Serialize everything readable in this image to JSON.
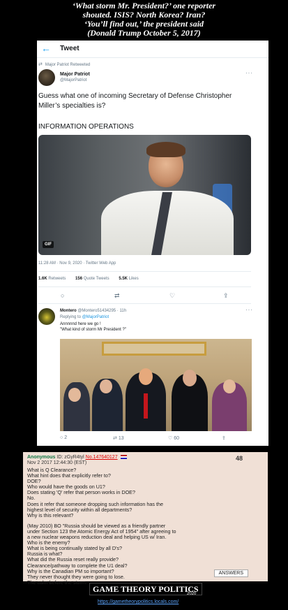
{
  "caption": {
    "line1": "‘What storm Mr. President?’ one reporter",
    "line2": "shouted. ISIS? North Korea? Iran?",
    "line3": "‘You’ll find out,’ the president said",
    "line4": "(Donald Trump October 5, 2017)"
  },
  "tweet": {
    "header_title": "Tweet",
    "retweet_label": "Major Patriot Retweeted",
    "author_name": "Major Patriot",
    "author_handle": "@MajorPatriot",
    "more_label": "···",
    "body": "Guess what one of incoming Secretary of Defense Christopher Miller’s specialties is?",
    "body2": "INFORMATION OPERATIONS",
    "gif_badge": "GIF",
    "meta": "11:28 AM · Nov 9, 2020 · Twitter Web App",
    "stats": [
      {
        "count": "1.6K",
        "label": "Retweets"
      },
      {
        "count": "156",
        "label": "Quote Tweets"
      },
      {
        "count": "5.5K",
        "label": "Likes"
      }
    ]
  },
  "reply": {
    "name": "Montero",
    "handle_time": "@Montero51434295 · 11h",
    "replying_prefix": "Replying to",
    "replying_handle": "@MajorPatriot",
    "line1": "Annnnnd here we go !",
    "line2": "\"What kind of storm Mr President ?\"",
    "reply_count": "2",
    "retweet_count": "13",
    "like_count": "60"
  },
  "forum": {
    "name": "Anonymous",
    "id": "ID: zGyR4tyl",
    "no": "No.147640127",
    "count": "48",
    "date": "Nov 2 2017 12:44:30 (EST)",
    "lines_a": [
      "What is Q Clearance?",
      "What hint does that explicitly refer to?",
      "DOE?",
      "Who would have the goods on U1?",
      "Does stating 'Q' refer that person works in DOE?",
      "No.",
      "Does it refer that someone dropping such information has the",
      "highest level of security within all departments?",
      "Why is this relevant?"
    ],
    "lines_b": [
      "(May 2010) BO \"Russia should be viewed as a friendly partner",
      "under Section 123 the Atomic Energy Act of 1954\" after agreeing to",
      "a new nuclear weapons reduction deal and helping US w/ Iran.",
      "Who is the enemy?",
      "What is being continually stated by all D's?",
      "Russia is what?",
      "What did the Russia reset really provide?",
      "Clearance/pathway to complete the U1 deal?",
      "Why is the Canadian PM so important?",
      "They never thought they were going to lose.",
      "The calm before the storm."
    ],
    "answers_label": "ANSWERS"
  },
  "brand": {
    "name": "GAME THEORY POLITICS",
    "year": "2020",
    "url": "https://gametheorypolitics.locals.com/"
  }
}
